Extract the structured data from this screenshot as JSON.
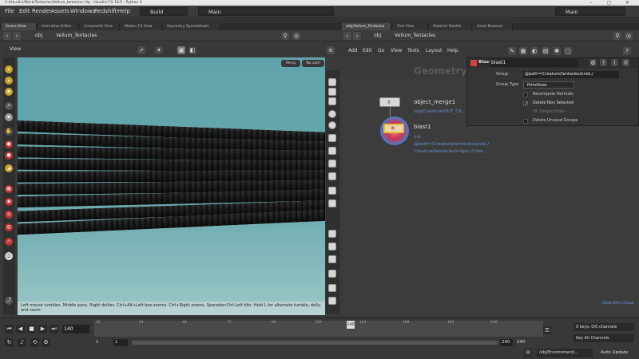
{
  "window": {
    "title": "C:/Houdini/Work/Tentacles/Vellum_tentacles.hip - Houdini FX 18.5 - Python 3",
    "controls": "– ▢ ✕"
  },
  "menubar": {
    "items": [
      "File",
      "Edit",
      "Render",
      "Assets",
      "Windows",
      "Redshift",
      "Help"
    ],
    "desktop": "Build",
    "context": "Main",
    "right_context": "Main"
  },
  "left_tabs": [
    "Scene View",
    "Animation Editor",
    "Composite View",
    "Motion FX View",
    "Geometry Spreadsheet"
  ],
  "right_tabs": [
    "/obj/Vellum_Tentacles",
    "Tree View",
    "Material Palette",
    "Asset Browner"
  ],
  "left_path": {
    "root": "obj",
    "node": "Vellum_Tentacles"
  },
  "viewport": {
    "label": "View",
    "persp": "Persp",
    "cam": "No cam",
    "hint": "Left mouse tumbles. Middle pans. Right dollies. Ctrl+Alt+Left box-zooms. Ctrl+Right zooms. Spacebar-Ctrl-Left tilts. Hold L for alternate tumble, dolly, and zoom."
  },
  "right_path": {
    "root": "obj",
    "node": "Vellum_Tentacles"
  },
  "net_menu": [
    "Add",
    "Edit",
    "Go",
    "View",
    "Tools",
    "Layout",
    "Help"
  ],
  "network": {
    "context_label": "Geometry",
    "watermark": "OpenDir.Cloud",
    "node1": {
      "name": "object_merge1",
      "path": "/obj/Creature/OUT_CR..."
    },
    "node2": {
      "name": "blast1",
      "param_line1": "not",
      "param_line2": "@path=/Creature/tentacles/ends,/",
      "param_line3": "Creature/tentacles/ridges,/Crea..."
    }
  },
  "parm_panel": {
    "node_type": "Blast",
    "node_name": "blast1",
    "group_label": "Group",
    "group_value": "@path=/Creature/tentacles/ends,/",
    "group_type_label": "Group Type",
    "group_type_value": "Primitives",
    "checks": [
      {
        "label": "Recompute Normals",
        "checked": false
      },
      {
        "label": "Delete Non Selected",
        "checked": true
      },
      {
        "label": "Fill Simple Holes",
        "checked": false
      },
      {
        "label": "Delete Unused Groups",
        "checked": false
      }
    ]
  },
  "timeline": {
    "frame": "140",
    "ticks": [
      "12",
      "24",
      "48",
      "72",
      "96",
      "120",
      "144",
      "168",
      "192",
      "216"
    ],
    "cursor_frame": "140",
    "start": "1",
    "start2": "1",
    "end": "240",
    "end2": "240",
    "keys": "0 keys, 0/0 channels",
    "key_channels": "Key All Channels",
    "obj_path": "/obj/Environment/...",
    "auto_update": "Auto Update"
  }
}
